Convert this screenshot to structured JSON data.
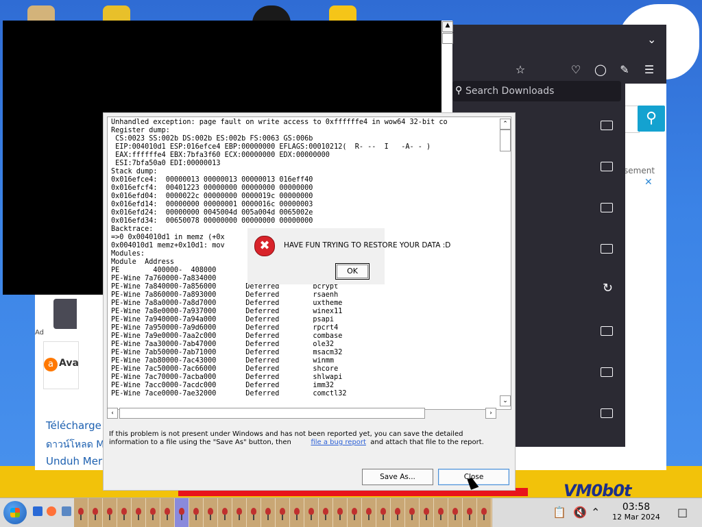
{
  "firefox": {
    "search_downloads_placeholder": "Search Downloads",
    "ad_text": "sement",
    "links": [
      "Télécharge",
      "ดาวน์โหลด M",
      "Unduh Mer"
    ],
    "ad_label": "Ad",
    "avast_text": "Ava"
  },
  "crash": {
    "log_text": "Unhandled exception: page fault on write access to 0xffffffe4 in wow64 32-bit co\nRegister dump:\n CS:0023 SS:002b DS:002b ES:002b FS:0063 GS:006b\n EIP:004010d1 ESP:016efce4 EBP:00000000 EFLAGS:00010212(  R- --  I   -A- - )\n EAX:ffffffe4 EBX:7bfa3f60 ECX:00000000 EDX:00000000\n ESI:7bfa50a0 EDI:00000013\nStack dump:\n0x016efce4:  00000013 00000013 00000013 016eff40\n0x016efcf4:  00401223 00000000 00000000 00000000\n0x016efd04:  0000022c 00000000 0000019c 00000000\n0x016efd14:  00000000 00000001 0000016c 00000003\n0x016efd24:  00000000 0045004d 005a004d 0065002e\n0x016efd34:  00650078 00000000 00000000 00000000\nBacktrace:\n=>0 0x004010d1 in memz (+0x\n0x004010d1 memz+0x10d1: mov\nModules:\nModule  Address\nPE        400000-  408000\nPE-Wine 7a760000-7a834000\nPE-Wine 7a840000-7a856000       Deferred        bcrypt\nPE-Wine 7a860000-7a893000       Deferred        rsaenh\nPE-Wine 7a8a0000-7a8d7000       Deferred        uxtheme\nPE-Wine 7a8e0000-7a937000       Deferred        winex11\nPE-Wine 7a940000-7a94a000       Deferred        psapi\nPE-Wine 7a950000-7a9d6000       Deferred        rpcrt4\nPE-Wine 7a9e0000-7aa2c000       Deferred        combase\nPE-Wine 7aa30000-7ab47000       Deferred        ole32\nPE-Wine 7ab50000-7ab71000       Deferred        msacm32\nPE-Wine 7ab80000-7ac43000       Deferred        winmm\nPE-Wine 7ac50000-7ac66000       Deferred        shcore\nPE-Wine 7ac70000-7acba000       Deferred        shlwapi\nPE-Wine 7acc0000-7acdc000       Deferred        imm32\nPE-Wine 7ace0000-7ae32000       Deferred        comctl32",
    "info_text_1": "If this problem is not present under Windows and has not been reported yet, you can save the detailed",
    "info_text_2a": "information to a file using the \"Save As\" button, then",
    "info_link": "file a bug report",
    "info_text_2b": "and attach that file to the report.",
    "save_as_label": "Save As...",
    "close_label": "Close"
  },
  "message_box": {
    "text": "HAVE FUN TRYING TO RESTORE YOUR DATA :D",
    "ok_label": "OK"
  },
  "watermark": "VM0b0t",
  "clock": {
    "time": "03:58",
    "date": "12 Mar 2024"
  },
  "colors": {
    "firefox_dark": "#2b2a33",
    "error_red": "#d8232a",
    "taskbar": "#dcdcdc"
  }
}
